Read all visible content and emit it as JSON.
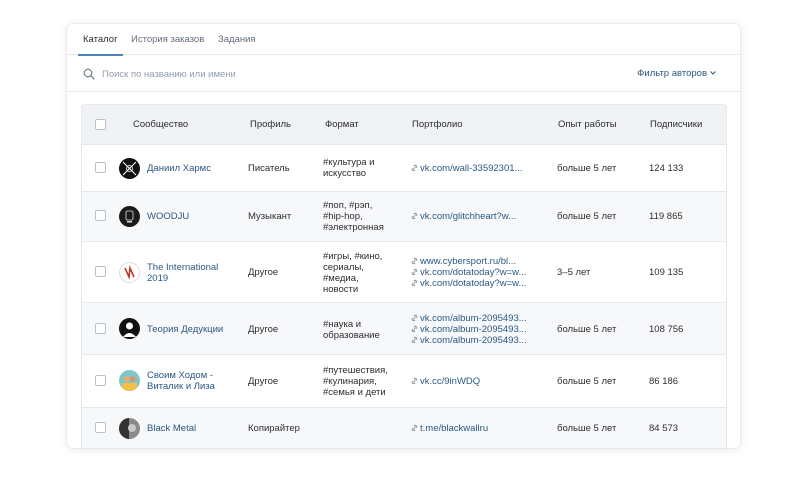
{
  "tabs": [
    {
      "label": "Каталог",
      "active": true
    },
    {
      "label": "История заказов",
      "active": false
    },
    {
      "label": "Задания",
      "active": false
    }
  ],
  "search": {
    "placeholder": "Поиск по названию или имени",
    "icon": "search-icon"
  },
  "filter": {
    "label": "Фильтр авторов",
    "icon": "chevron-down-icon"
  },
  "table": {
    "headers": {
      "community": "Сообщество",
      "profile": "Профиль",
      "format": "Формат",
      "portfolio": "Портфолио",
      "experience": "Опыт работы",
      "subscribers": "Подписчики"
    },
    "rows": [
      {
        "name": [
          "Даниил Хармс"
        ],
        "profile": "Писатель",
        "format": [
          "#культура и",
          "искусство"
        ],
        "portfolio": [
          "vk.com/wall-33592301..."
        ],
        "experience": "больше 5 лет",
        "subscribers": "124 133"
      },
      {
        "name": [
          "WOODJU"
        ],
        "profile": "Музыкант",
        "format": [
          "#поп, #рэп,",
          "#hip-hop,",
          "#электронная"
        ],
        "portfolio": [
          "vk.com/glitchheart?w..."
        ],
        "experience": "больше 5 лет",
        "subscribers": "119 865"
      },
      {
        "name": [
          "The International",
          "2019"
        ],
        "profile": "Другое",
        "format": [
          "#игры, #кино,",
          "сериалы,",
          "#медиа,",
          "новости"
        ],
        "portfolio": [
          "www.cybersport.ru/bl...",
          "vk.com/dotatoday?w=w...",
          "vk.com/dotatoday?w=w..."
        ],
        "experience": "3–5 лет",
        "subscribers": "109 135"
      },
      {
        "name": [
          "Теория Дедукции"
        ],
        "profile": "Другое",
        "format": [
          "#наука и",
          "образование"
        ],
        "portfolio": [
          "vk.com/album-2095493...",
          "vk.com/album-2095493...",
          "vk.com/album-2095493..."
        ],
        "experience": "больше 5 лет",
        "subscribers": "108 756"
      },
      {
        "name": [
          "Своим Ходом -",
          "Виталик и Лиза"
        ],
        "profile": "Другое",
        "format": [
          "#путешествия,",
          "#кулинария,",
          "#семья и дети"
        ],
        "portfolio": [
          "vk.cc/9inWDQ"
        ],
        "experience": "больше 5 лет",
        "subscribers": "86 186"
      },
      {
        "name": [
          "Black Metal"
        ],
        "profile": "Копирайтер",
        "format": [],
        "portfolio": [
          "t.me/blackwallru"
        ],
        "experience": "больше 5 лет",
        "subscribers": "84 573"
      }
    ]
  },
  "colors": {
    "accent": "#5181b8",
    "link": "#2a5885",
    "header_bg": "#f0f2f5",
    "border": "#e7e8ec"
  }
}
